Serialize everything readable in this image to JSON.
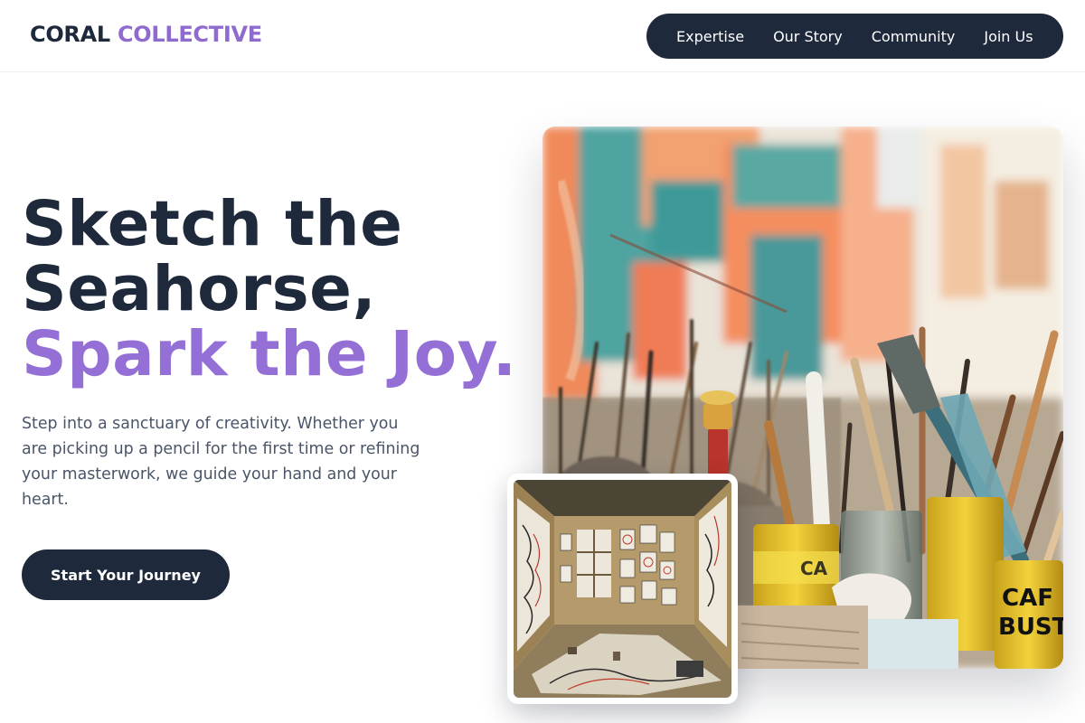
{
  "brand": {
    "part1": "CORAL",
    "part2": "COLLECTIVE",
    "accent_color": "#8f6bd0",
    "dark_color": "#1e293b"
  },
  "nav": {
    "items": [
      {
        "label": "Expertise"
      },
      {
        "label": "Our Story"
      },
      {
        "label": "Community"
      },
      {
        "label": "Join Us"
      }
    ]
  },
  "hero": {
    "title_line1": "Sketch the",
    "title_line2": "Seahorse,",
    "title_line3": "Spark the Joy.",
    "description": "Step into a sanctuary of creativity. Whether you are picking up a pencil for the first time or refining your masterwork, we guide your hand and your heart.",
    "cta_label": "Start Your Journey"
  },
  "images": {
    "main_alt": "Paint brushes in jars in front of colorful abstract painting",
    "secondary_alt": "Art studio room with drawings covering the walls and floor"
  }
}
